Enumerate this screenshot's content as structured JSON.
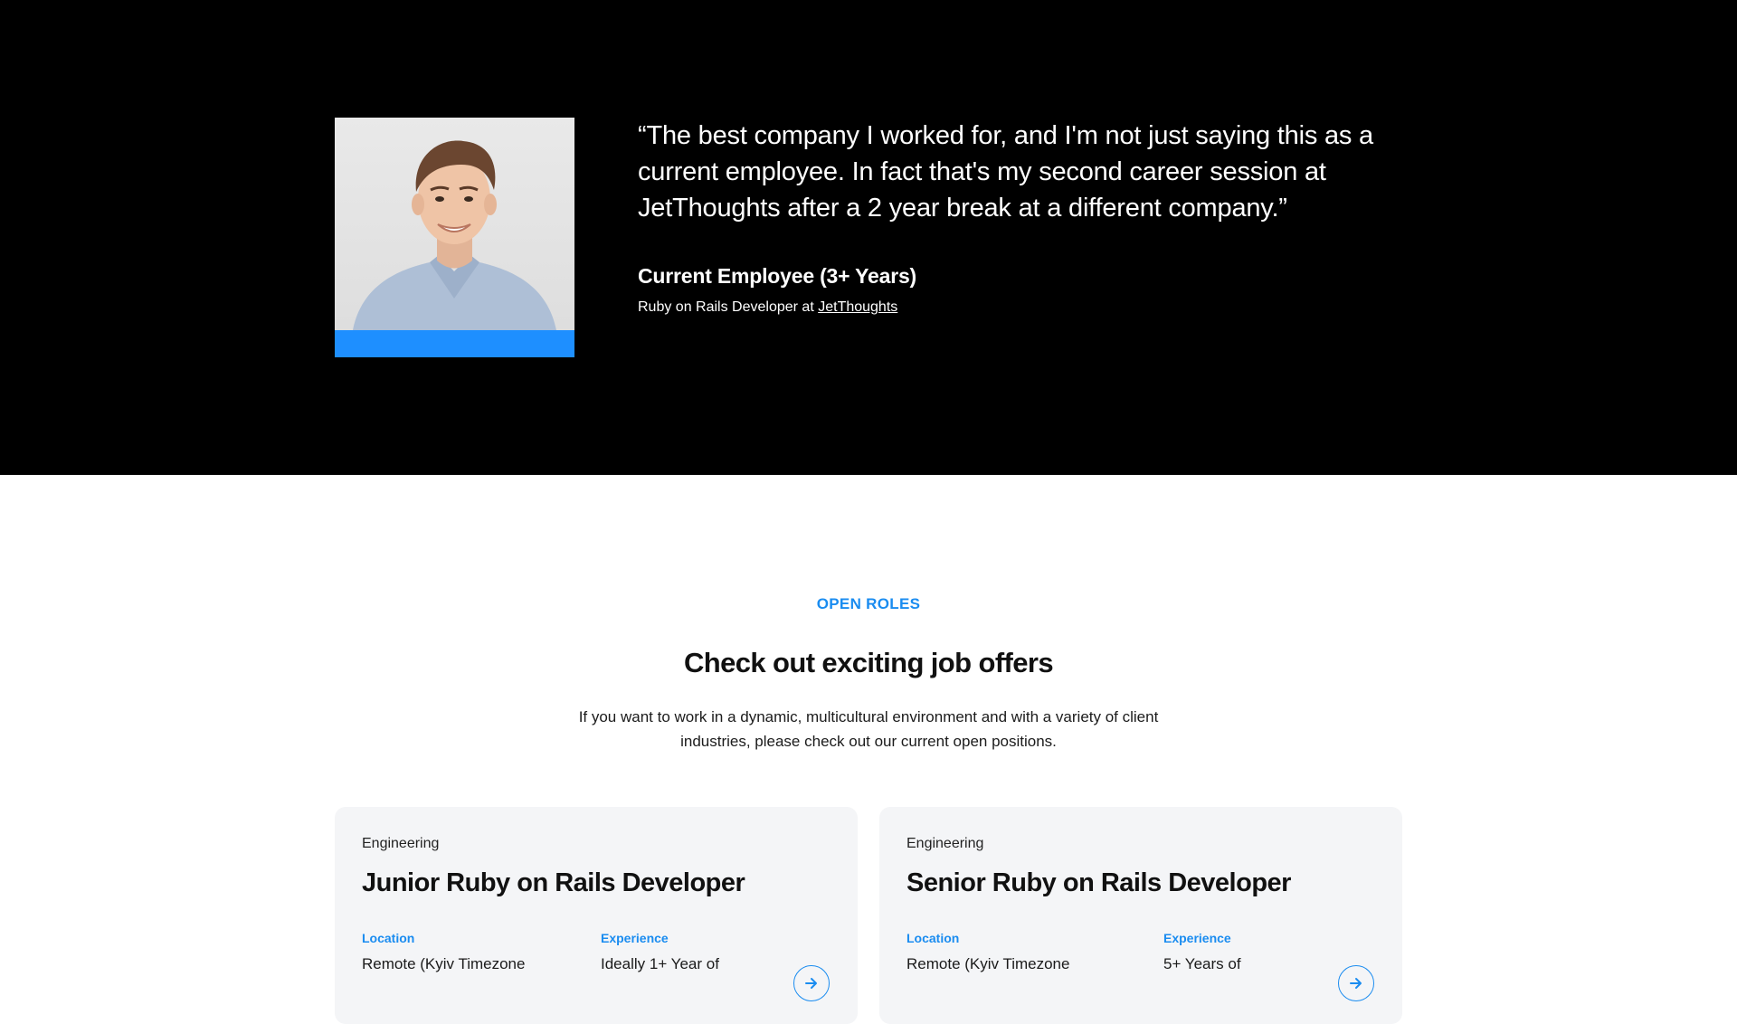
{
  "testimonial": {
    "quote": "“The best company I worked for, and I'm not just saying this as a current employee. In fact that's my second career session at JetThoughts after a 2 year break at a different company.”",
    "author_name": "Current Employee (3+ Years)",
    "author_role_prefix": "Ruby on Rails Developer at ",
    "author_company": "JetThoughts",
    "photo_icon": "employee-portrait",
    "accent_color": "#1e8fff"
  },
  "open_roles": {
    "eyebrow": "OPEN ROLES",
    "title": "Check out exciting job offers",
    "description": "If you want to work in a dynamic, multicultural environment and with a variety of client industries, please check out our current open positions.",
    "jobs": [
      {
        "department": "Engineering",
        "title": "Junior Ruby on Rails Developer",
        "location_label": "Location",
        "location_value": "Remote (Kyiv Timezone",
        "experience_label": "Experience",
        "experience_value": "Ideally 1+ Year of"
      },
      {
        "department": "Engineering",
        "title": "Senior Ruby on Rails Developer",
        "location_label": "Location",
        "location_value": "Remote (Kyiv Timezone",
        "experience_label": "Experience",
        "experience_value": "5+ Years of"
      }
    ],
    "accent_color": "#1a8cf0",
    "arrow_icon": "arrow-right-icon"
  }
}
